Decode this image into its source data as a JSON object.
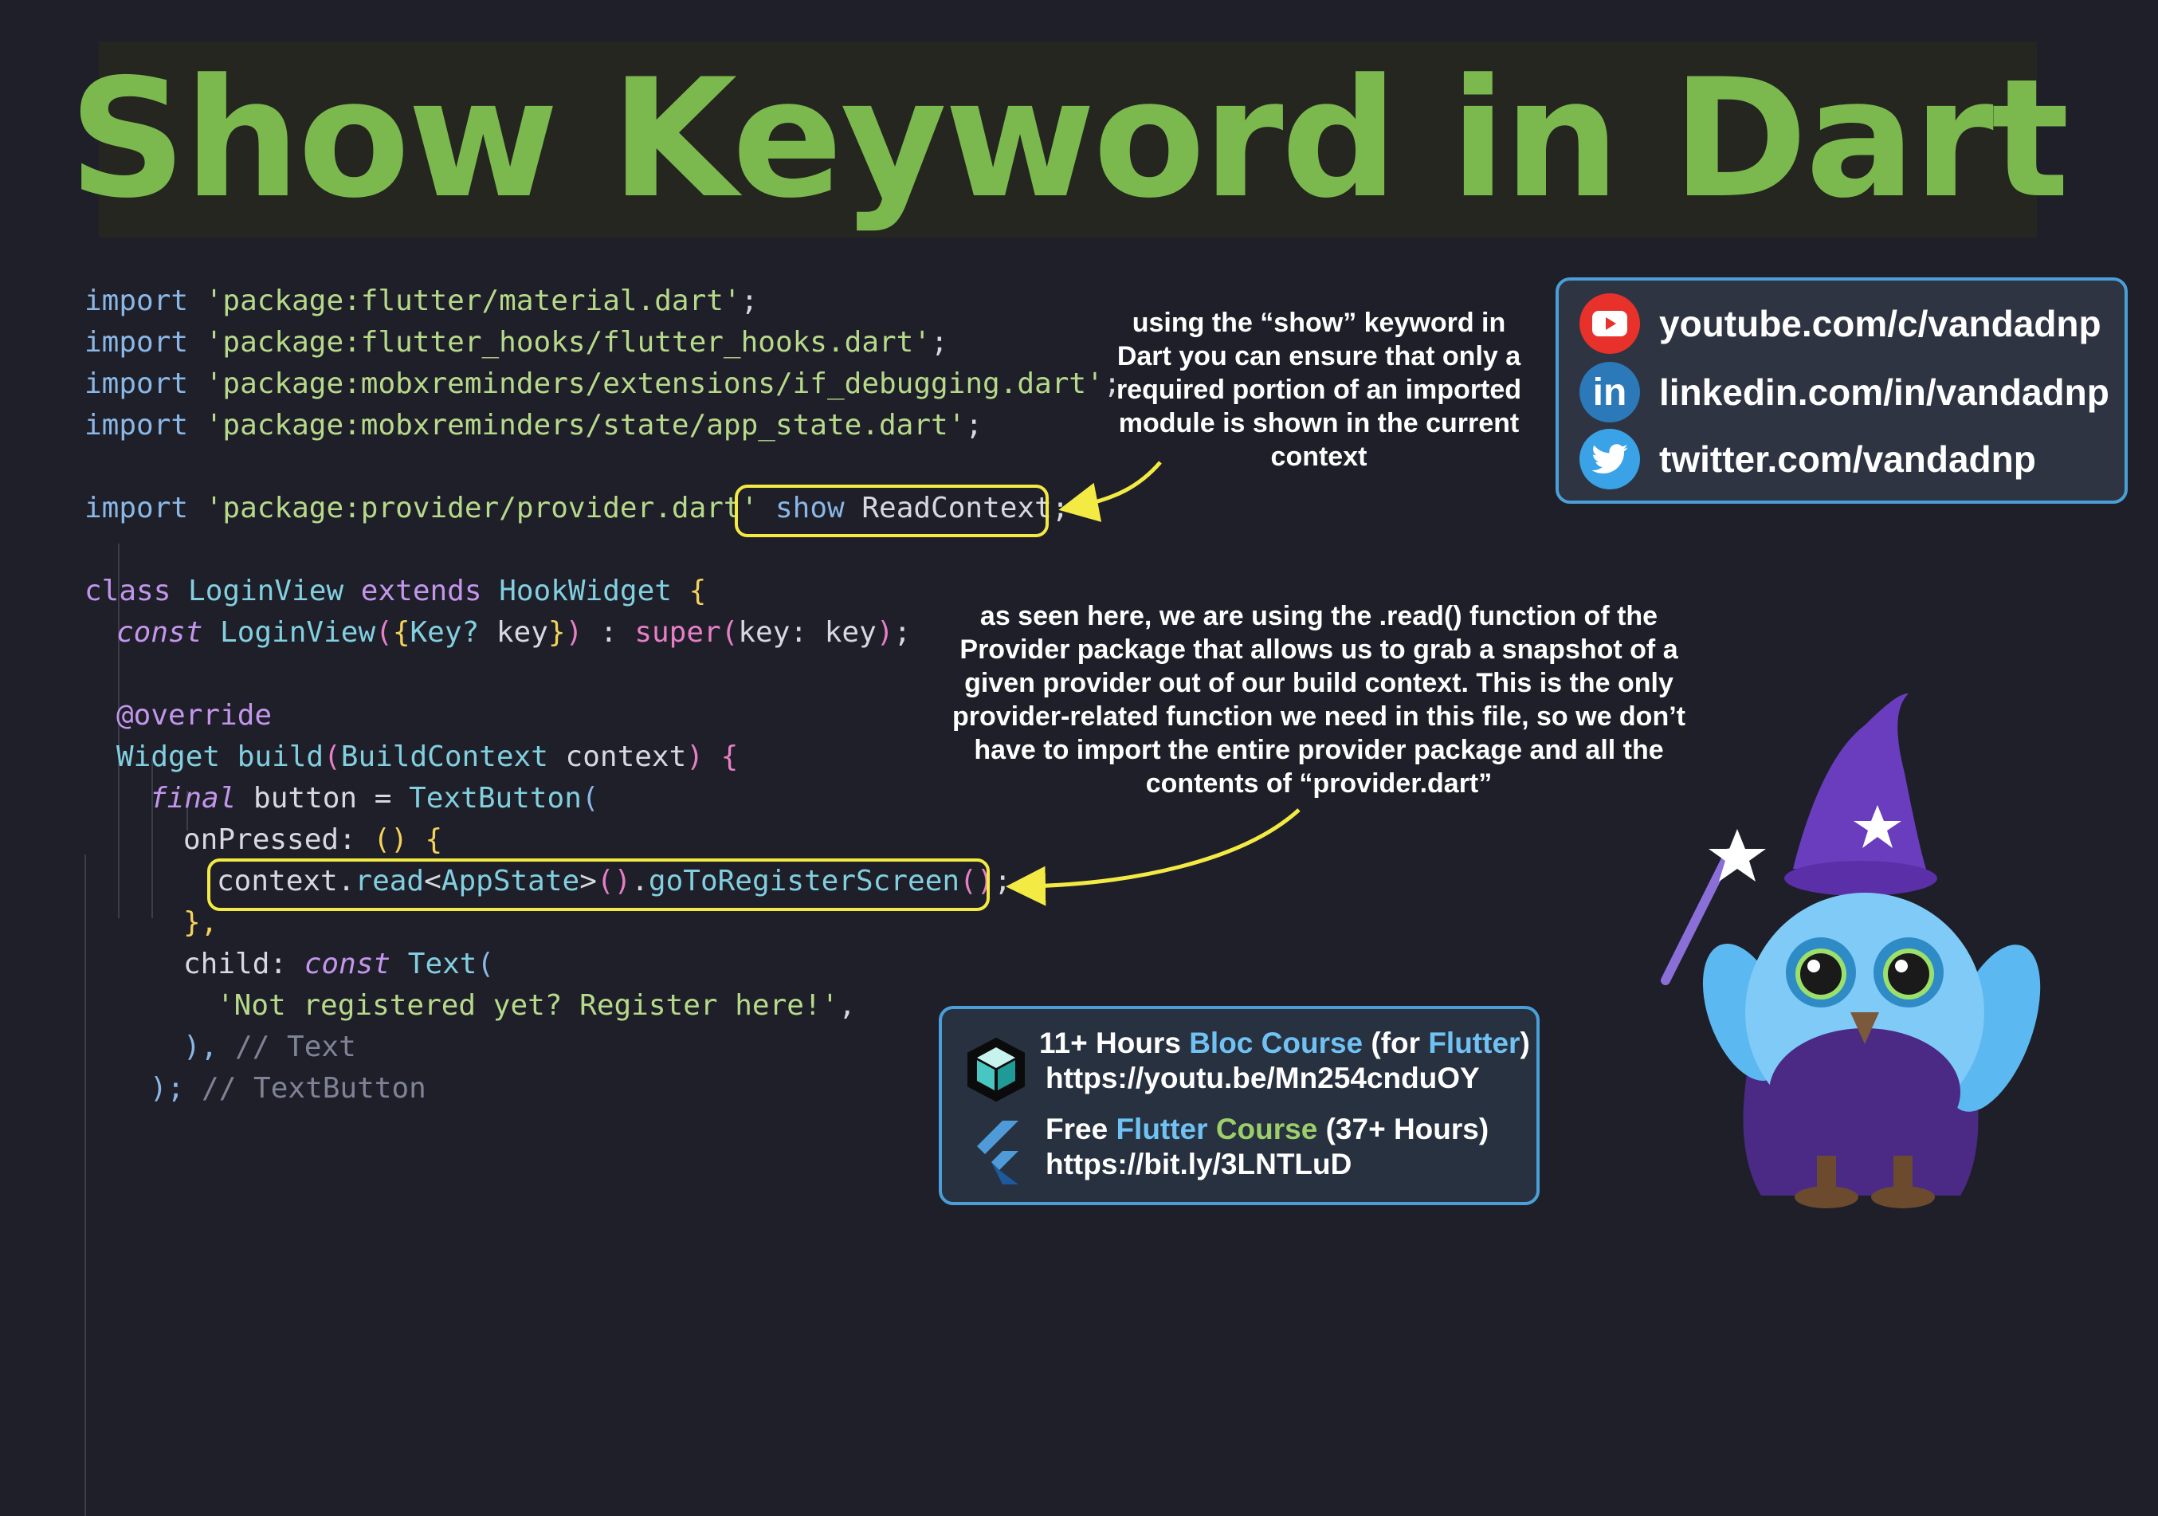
{
  "title": "Show Keyword in Dart",
  "code_lines": {
    "l1_kw": "import",
    "l1_str": " 'package:flutter/material.dart'",
    "l1_end": ";",
    "l2_kw": "import",
    "l2_str": " 'package:flutter_hooks/flutter_hooks.dart'",
    "l2_end": ";",
    "l3_kw": "import",
    "l3_str": " 'package:mobxreminders/extensions/if_debugging.dart'",
    "l3_end": ";",
    "l4_kw": "import",
    "l4_str": " 'package:mobxreminders/state/app_state.dart'",
    "l4_end": ";",
    "l5_kw": "import",
    "l5_str": " 'package:provider/provider.dart'",
    "l5_show": "show",
    "l5_name": " ReadContext",
    "l5_end": ";",
    "l6_class": "class",
    "l6_name": " LoginView",
    "l6_extends": " extends",
    "l6_super": " HookWidget",
    "l6_brace": " {",
    "l7_const": "const",
    "l7_name": " LoginView",
    "l7_open": "(",
    "l7_brace1": "{",
    "l7_type": "Key?",
    "l7_key": " key",
    "l7_brace2": "}",
    "l7_close": ")",
    "l7_colon": " :",
    "l7_super": " super",
    "l7_args_open": "(",
    "l7_args": "key: key",
    "l7_args_close": ")",
    "l7_end": ";",
    "l8_override": "@override",
    "l9_type": "Widget",
    "l9_fn": " build",
    "l9_open": "(",
    "l9_ptype": "BuildContext",
    "l9_param": " context",
    "l9_close": ")",
    "l9_brace": " {",
    "l10_final": "final",
    "l10_var": " button =",
    "l10_cls": " TextButton",
    "l10_open": "(",
    "l11_prop": "onPressed:",
    "l11_parens": " ()",
    "l11_brace": " {",
    "l12_ctx": "context",
    "l12_dot": ".",
    "l12_read": "read",
    "l12_lt": "<",
    "l12_type": "AppState",
    "l12_gt": ">",
    "l12_p": "()",
    "l12_dot2": ".",
    "l12_fn": "goToRegisterScreen",
    "l12_p2": "()",
    "l12_end": ";",
    "l13": "},",
    "l14_prop": "child:",
    "l14_const": " const",
    "l14_cls": " Text",
    "l14_open": "(",
    "l15_str": "'Not registered yet? Register here!'",
    "l15_end": ",",
    "l16_close": "),",
    "l16_cmt": " // Text",
    "l17_close": ");",
    "l17_cmt": " // TextButton"
  },
  "notes": {
    "show_note": "using the “show” keyword in Dart you can ensure that only a required portion of an imported module is shown in the current context",
    "read_note": "as seen here, we are using the .read() function of the Provider package that allows us to grab a snapshot of a given provider out of our build context. This is the only provider-related function we need in this file, so we don’t have to import the entire provider package and all the contents of “provider.dart”"
  },
  "social": {
    "youtube": "youtube.com/c/vandadnp",
    "linkedin": "linkedin.com/in/vandadnp",
    "twitter": "twitter.com/vandadnp",
    "linkedin_glyph": "in"
  },
  "courses": {
    "c1_a": "11+ Hours ",
    "c1_b": "Bloc Course",
    "c1_c": " (for ",
    "c1_d": "Flutter",
    "c1_e": ")",
    "c1_url": "https://youtu.be/Mn254cnduOY",
    "c2_a": "Free ",
    "c2_b": "Flutter",
    "c2_c": " Course",
    "c2_d": " (37+ Hours)",
    "c2_url": "https://bit.ly/3LNTLuD"
  },
  "colors": {
    "title": "#7bb94f",
    "highlight": "#f4ea44",
    "box_border": "#4a9fd8",
    "youtube": "#e8312b",
    "linkedin": "#2b79b8",
    "twitter": "#3aa2e6"
  },
  "icons": [
    "youtube-icon",
    "linkedin-icon",
    "twitter-icon",
    "bloc-cube-icon",
    "flutter-icon",
    "wizard-owl-mascot"
  ]
}
